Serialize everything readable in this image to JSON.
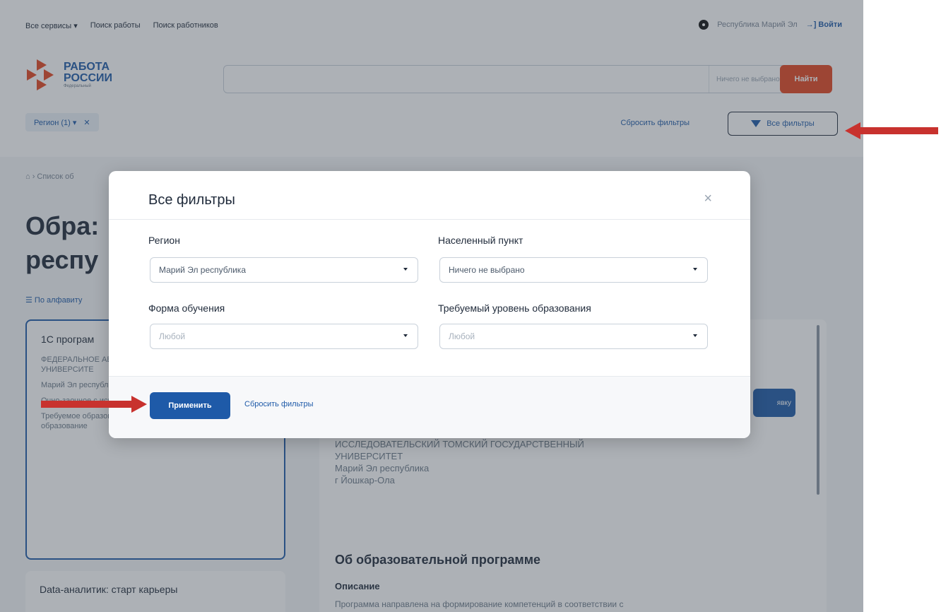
{
  "topbar": {
    "nav": [
      "Все сервисы ▾",
      "Поиск работы",
      "Поиск работников"
    ],
    "region": "Республика Марий Эл",
    "login": "Войти"
  },
  "header": {
    "logo_line1": "РАБОТА",
    "logo_line2": "РОССИИ",
    "logo_sub": "Федеральный",
    "search_select": "Ничего не выбрано",
    "find_button": "Найти",
    "region_chip": "Регион (1) ▾",
    "chip_close": "✕",
    "reset_filters": "Сбросить фильтры",
    "all_filters": "Все фильтры"
  },
  "content": {
    "breadcrumb": "⌂ › Список об",
    "heading": "Обра… респу…",
    "heading_line1": "Обра:",
    "heading_line2": "респу",
    "sort": "☰ По алфавиту",
    "card1": {
      "title": "1С програм",
      "lines": [
        "ФЕДЕРАЛЬНОЕ АВТОНОМНОЕ УЧРЕЖДЕНИЕ ТОМСКИЙ ГО УНИВЕРСИТЕ",
        "Марий Эл республика",
        "Очно-заочное с использованием дистанционных технологий",
        "Требуемое образование: Среднее профессиональное образование"
      ]
    },
    "card2_title": "Data-аналитик: старт карьеры",
    "detail_org": [
      "ИССЛЕДОВАТЕЛЬСКИЙ ТОМСКИЙ ГОСУДАРСТВЕННЫЙ",
      "УНИВЕРСИТЕТ",
      "Марий Эл республика",
      "г Йошкар-Ола"
    ],
    "about": "Об образовательной программе",
    "desc_heading": "Описание",
    "desc": "Программа направлена на формирование компетенций в соответствии с",
    "apply_back": "явку"
  },
  "modal": {
    "title": "Все фильтры",
    "close": "×",
    "region_label": "Регион",
    "region_value": "Марий Эл республика",
    "locality_label": "Населенный пункт",
    "locality_value": "Ничего не выбрано",
    "form_label": "Форма обучения",
    "form_value": "Любой",
    "edu_label": "Требуемый уровень образования",
    "edu_value": "Любой",
    "apply": "Применить",
    "reset": "Сбросить фильтры"
  },
  "colors": {
    "brand_blue": "#1e5aa8",
    "accent_orange": "#e4461f",
    "annotation_red": "#c8322e"
  }
}
